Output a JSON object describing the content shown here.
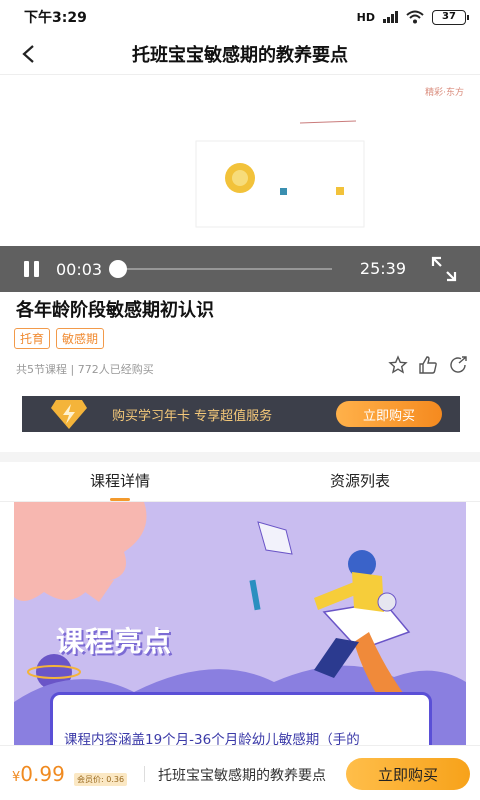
{
  "status_bar": {
    "time": "下午3:29",
    "signal": "HD",
    "battery": "37"
  },
  "nav": {
    "title": "托班宝宝敏感期的教养要点"
  },
  "video": {
    "logo_text": "精彩·东方",
    "current_time": "00:03",
    "total_time": "25:39",
    "progress": 0.0
  },
  "course": {
    "title": "各年龄阶段敏感期初认识",
    "tags": [
      "托育",
      "敏感期"
    ],
    "meta": "共5节课程 | 772人已经购买"
  },
  "promo": {
    "text": "购买学习年卡 专享超值服务",
    "button": "立即购买"
  },
  "tabs": [
    {
      "label": "课程详情",
      "active": true
    },
    {
      "label": "资源列表",
      "active": false
    }
  ],
  "detail": {
    "highlight_title": "课程亮点",
    "text": "课程内容涵盖19个月-36个月龄幼儿敏感期（手的"
  },
  "bottom_bar": {
    "currency": "¥",
    "price": "0.99",
    "member_price": "会员价: 0.36",
    "course_name": "托班宝宝敏感期的教养要点",
    "buy_label": "立即购买"
  },
  "colors": {
    "accent": "#f39a2c",
    "promo_bg": "#3c3f4a",
    "detail_bg": "#c9bdf0"
  }
}
